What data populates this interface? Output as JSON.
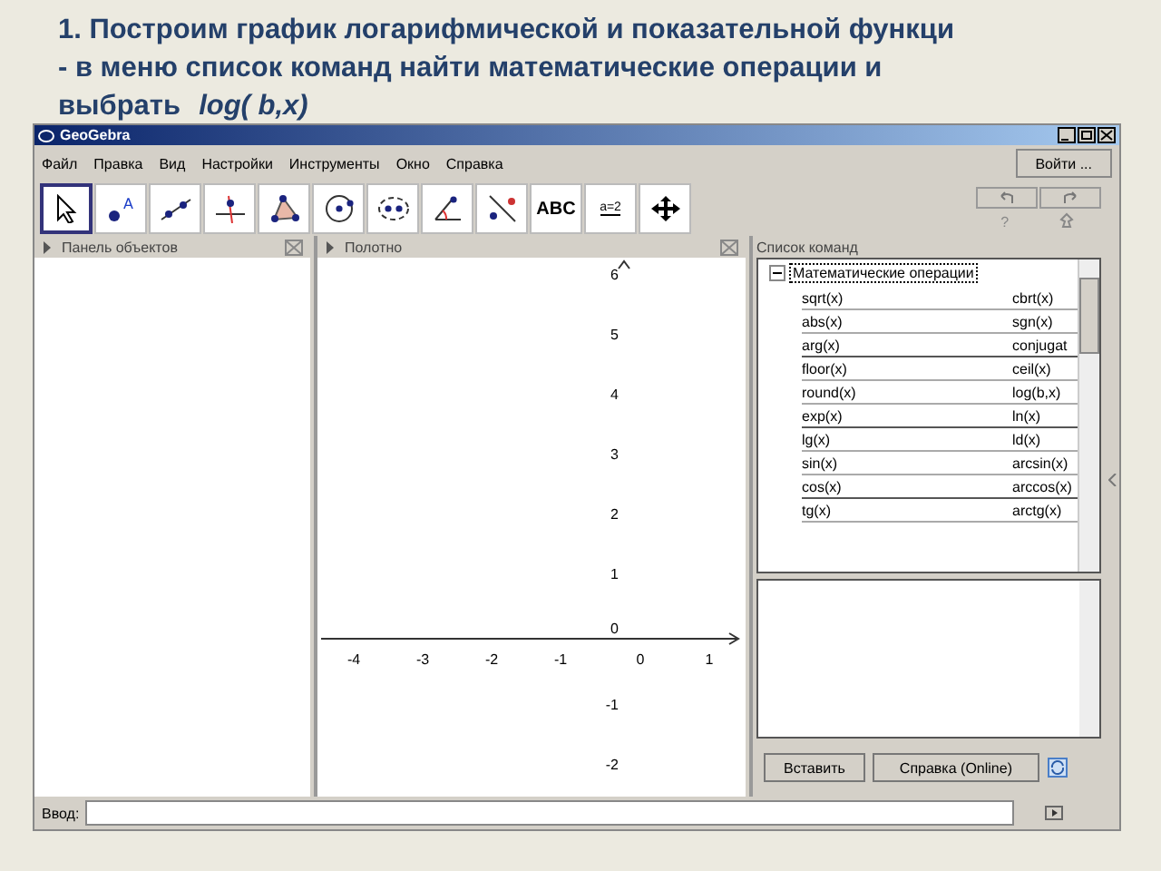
{
  "heading": [
    "1. Построим график логарифмической  и показательной функци",
    "- в меню список команд найти  математические операции и"
  ],
  "heading_last": {
    "text": "выбрать",
    "formula": "log( b,x)"
  },
  "window": {
    "title": "GeoGebra"
  },
  "menu": [
    "Файл",
    "Правка",
    "Вид",
    "Настройки",
    "Инструменты",
    "Окно",
    "Справка"
  ],
  "login_button": "Войти ...",
  "tools": [
    {
      "kind": "move",
      "selected": true
    },
    {
      "kind": "point",
      "label": "A",
      "selected": false
    },
    {
      "kind": "line",
      "selected": false
    },
    {
      "kind": "perpendicular",
      "selected": false
    },
    {
      "kind": "polygon",
      "selected": false
    },
    {
      "kind": "circle",
      "selected": false
    },
    {
      "kind": "conic",
      "selected": false
    },
    {
      "kind": "angle",
      "selected": false
    },
    {
      "kind": "reflect",
      "selected": false
    },
    {
      "kind": "text",
      "label": "ABC",
      "selected": false
    },
    {
      "kind": "slider",
      "label": "a=2",
      "selected": false
    },
    {
      "kind": "move_view",
      "selected": false
    }
  ],
  "help_mark": "?",
  "algebra_panel": {
    "title": "Панель объектов"
  },
  "graphics_panel": {
    "title": "Полотно",
    "x_ticks": [
      "-4",
      "-3",
      "-2",
      "-1",
      "0",
      "1"
    ],
    "y_ticks": [
      "6",
      "5",
      "4",
      "3",
      "2",
      "1",
      "0",
      "-1",
      "-2"
    ]
  },
  "command_panel": {
    "title": "Список команд",
    "category": {
      "label": "Математические операции",
      "expanded": true
    },
    "rows": [
      [
        "sqrt(x)",
        "cbrt(x)"
      ],
      [
        "abs(x)",
        "sgn(x)"
      ],
      [
        "arg(x)",
        "conjugat"
      ],
      [
        "floor(x)",
        "ceil(x)"
      ],
      [
        "round(x)",
        "log(b,x)"
      ],
      [
        "exp(x)",
        "ln(x)"
      ],
      [
        "lg(x)",
        "ld(x)"
      ],
      [
        "sin(x)",
        "arcsin(x)"
      ],
      [
        "cos(x)",
        "arccos(x)"
      ],
      [
        "tg(x)",
        "arctg(x)"
      ]
    ],
    "buttons": [
      "Вставить",
      "Справка (Online)"
    ]
  },
  "input_bar": {
    "label": "Ввод:"
  }
}
